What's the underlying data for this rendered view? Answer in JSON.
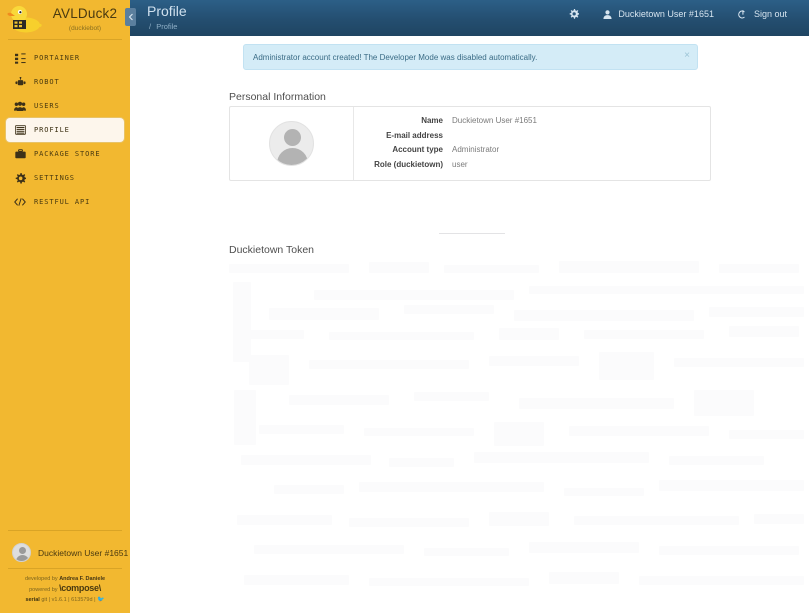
{
  "sidebar": {
    "brand": {
      "logo_icon": "duckiebot-duck-logo",
      "title": "AVLDuck2",
      "subtitle": "(duckiebot)"
    },
    "items": [
      {
        "label": "PORTAINER",
        "icon": "sitemap-icon",
        "active": false
      },
      {
        "label": "ROBOT",
        "icon": "robot-icon",
        "active": false
      },
      {
        "label": "USERS",
        "icon": "users-icon",
        "active": false
      },
      {
        "label": "PROFILE",
        "icon": "list-icon",
        "active": true
      },
      {
        "label": "PACKAGE STORE",
        "icon": "briefcase-icon",
        "active": false
      },
      {
        "label": "SETTINGS",
        "icon": "gear-icon",
        "active": false
      },
      {
        "label": "RESTFUL API",
        "icon": "code-icon",
        "active": false
      }
    ],
    "user": {
      "name": "Duckietown User #1651",
      "avatar_icon": "user-avatar-icon"
    },
    "footer": {
      "developed_prefix": "developed by",
      "developed_by": "Andrea F. Daniele",
      "powered_prefix": "powered by",
      "powered_by": "\\compose\\",
      "serial_label": "serial",
      "serial_value": "git",
      "version": "v1.6.1",
      "commit": "613579d",
      "duck_icon": "duck-icon",
      "separator": "|"
    }
  },
  "header": {
    "title": "Profile",
    "breadcrumb_separator": "/",
    "breadcrumb_current": "Profile",
    "collapse_icon": "chevron-left-icon",
    "settings_icon": "gear-icon",
    "user_icon": "user-icon",
    "user_name": "Duckietown User #1651",
    "signout_icon": "sign-out-icon",
    "signout_label": "Sign out"
  },
  "content": {
    "alert": {
      "message": "Administrator account created! The Developer Mode was disabled automatically.",
      "close_label": "×",
      "accent_color": "#d4ecf7"
    },
    "personal_information": {
      "title": "Personal Information",
      "avatar_icon": "user-avatar-icon",
      "fields": [
        {
          "label": "Name",
          "value": "Duckietown User #1651"
        },
        {
          "label": "E-mail address",
          "value": ""
        },
        {
          "label": "Account type",
          "value": "Administrator"
        },
        {
          "label": "Role (duckietown)",
          "value": "user"
        }
      ]
    },
    "duckietown_token": {
      "title": "Duckietown Token"
    }
  },
  "colors": {
    "sidebar_bg": "#f2b830",
    "header_bg": "#244e70",
    "active_item_bg": "#fdf6ec",
    "alert_bg": "#d4ecf7"
  }
}
